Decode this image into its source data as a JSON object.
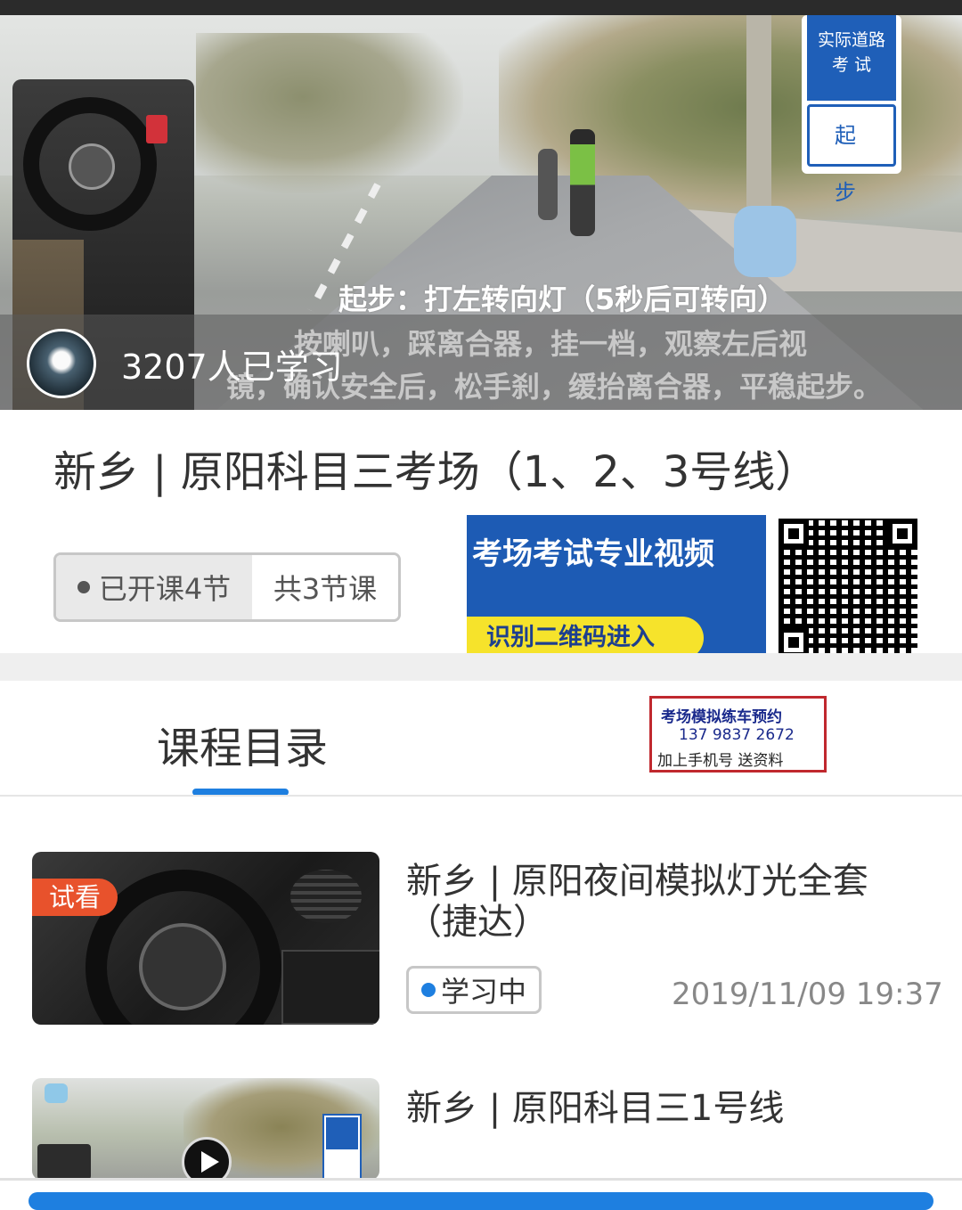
{
  "hero": {
    "sign_top": "实际道路 考 试",
    "sign_bottom": "起 步",
    "subtitle_line1": "起步：打左转向灯（5秒后可转向）",
    "subtitle_line2": "按喇叭，踩离合器，挂一档，观察左后视",
    "subtitle_line3": "镜，确认安全后，松手刹，缓抬离合器，平稳起步。",
    "learned_count": "3207人已学习"
  },
  "course": {
    "title": "新乡 | 原阳科目三考场（1、2、3号线）",
    "opened": "已开课4节",
    "total": "共3节课"
  },
  "ad": {
    "headline": "考场考试专业视频",
    "button": "识别二维码进入"
  },
  "tabs": {
    "catalog": "课程目录"
  },
  "promo": {
    "line1": "考场模拟练车预约",
    "line2": "137 9837 2672",
    "line3": "加上手机号   送资料"
  },
  "lessons": [
    {
      "badge": "试看",
      "title": "新乡 | 原阳夜间模拟灯光全套（捷达）",
      "status": "学习中",
      "time": "2019/11/09 19:37"
    },
    {
      "title": "新乡 | 原阳科目三1号线"
    }
  ],
  "colors": {
    "accent": "#1e7fe0",
    "trial": "#e8522c",
    "promo_border": "#c0282e",
    "ad_blue": "#1d5bb4",
    "ad_yellow": "#f6e32b"
  }
}
